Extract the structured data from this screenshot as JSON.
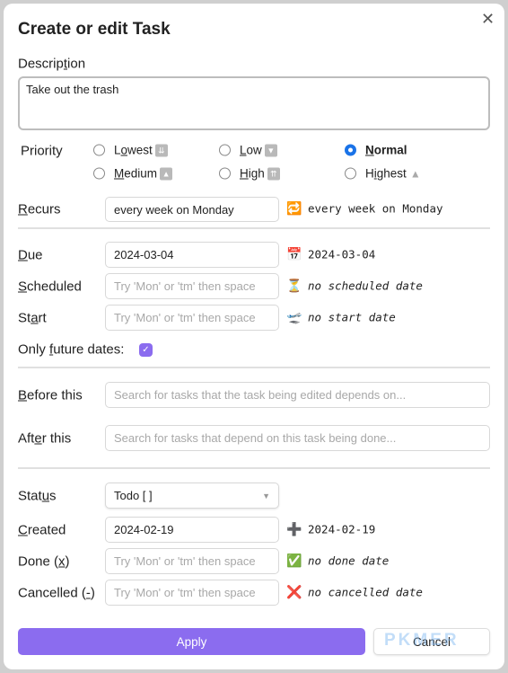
{
  "title": "Create or edit Task",
  "close_icon": "close-icon",
  "description": {
    "label": [
      "Descrip",
      "t",
      "ion"
    ],
    "value": "Take out the trash"
  },
  "priority": {
    "label": "Priority",
    "options": [
      {
        "pre": "L",
        "key": "o",
        "post": "west",
        "icon": "⏬",
        "checked": false
      },
      {
        "pre": "",
        "key": "L",
        "post": "ow",
        "icon": "🔽",
        "checked": false
      },
      {
        "pre": "",
        "key": "N",
        "post": "ormal",
        "icon": "",
        "checked": true
      },
      {
        "pre": "",
        "key": "M",
        "post": "edium",
        "icon": "🔼",
        "checked": false
      },
      {
        "pre": "",
        "key": "H",
        "post": "igh",
        "icon": "⏫",
        "checked": false
      },
      {
        "pre": "H",
        "key": "i",
        "post": "ghest",
        "icon": "🔺",
        "checked": false
      }
    ]
  },
  "recurs": {
    "label": [
      "",
      "R",
      "ecurs"
    ],
    "value": "every week on Monday",
    "icon": "🔁",
    "preview": "every week on Monday"
  },
  "due": {
    "label": [
      "",
      "D",
      "ue"
    ],
    "value": "2024-03-04",
    "icon": "📅",
    "preview": "2024-03-04"
  },
  "scheduled": {
    "label": [
      "",
      "S",
      "cheduled"
    ],
    "placeholder": "Try 'Mon' or 'tm' then space",
    "icon": "⏳",
    "preview": "no scheduled date"
  },
  "start": {
    "label": [
      "St",
      "a",
      "rt"
    ],
    "placeholder": "Try 'Mon' or 'tm' then space",
    "icon": "🛫",
    "preview": "no start date"
  },
  "only_future": {
    "label": [
      "Only ",
      "f",
      "uture dates:"
    ],
    "checked": true
  },
  "before_this": {
    "label": [
      "",
      "B",
      "efore this"
    ],
    "placeholder": "Search for tasks that the task being edited depends on..."
  },
  "after_this": {
    "label": [
      "Aft",
      "e",
      "r this"
    ],
    "placeholder": "Search for tasks that depend on this task being done..."
  },
  "status": {
    "label": [
      "Stat",
      "u",
      "s"
    ],
    "value": "Todo [ ]"
  },
  "created": {
    "label": [
      "",
      "C",
      "reated"
    ],
    "value": "2024-02-19",
    "icon": "➕",
    "preview": "2024-02-19"
  },
  "done": {
    "label": [
      "Done (",
      "x",
      ")"
    ],
    "placeholder": "Try 'Mon' or 'tm' then space",
    "icon": "✅",
    "preview": "no done date"
  },
  "cancelled": {
    "label": [
      "Cancelled (",
      "-",
      ")"
    ],
    "placeholder": "Try 'Mon' or 'tm' then space",
    "icon": "❌",
    "preview": "no cancelled date"
  },
  "buttons": {
    "apply": "Apply",
    "cancel": "Cancel"
  },
  "watermark": "PKMER",
  "colors": {
    "accent": "#8b6cef",
    "radio": "#1a73e8"
  }
}
